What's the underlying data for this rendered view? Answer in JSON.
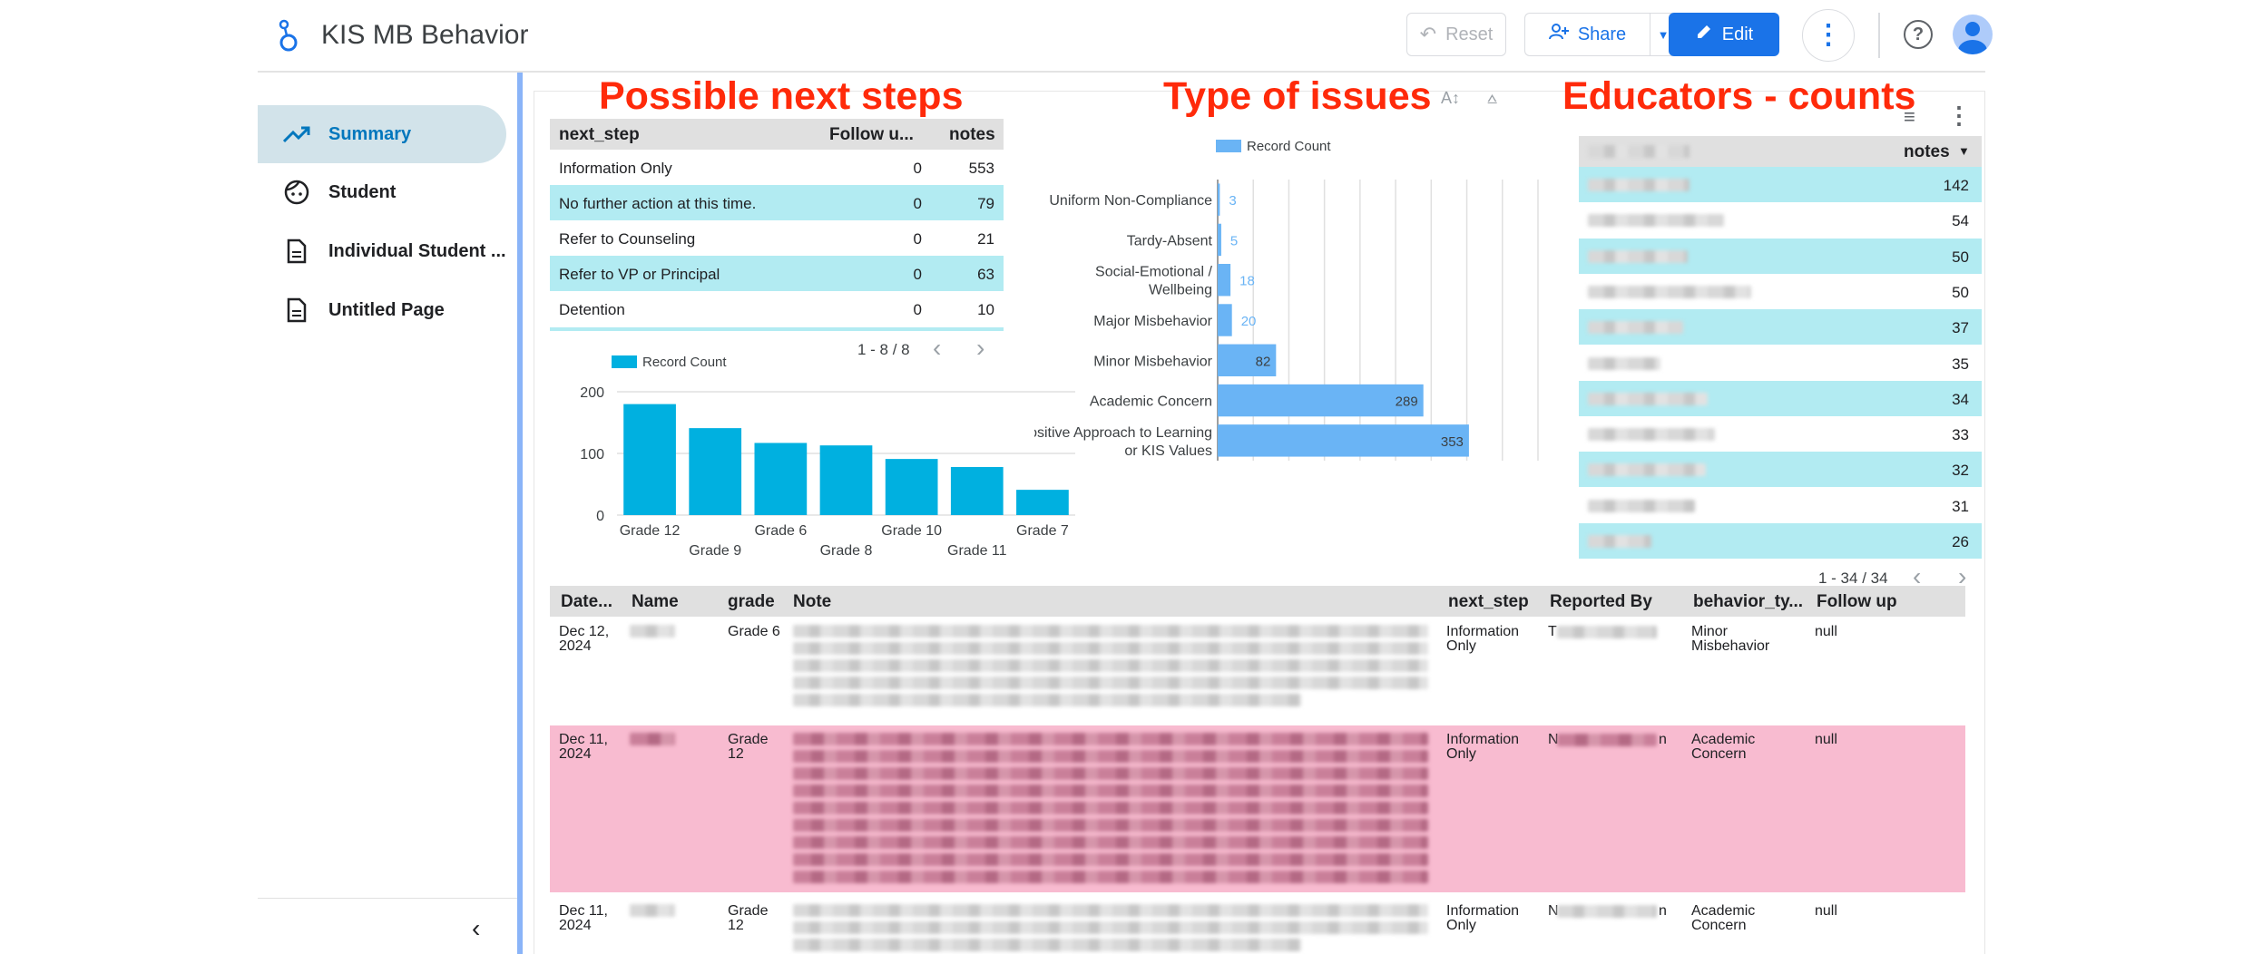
{
  "header": {
    "title": "KIS MB Behavior",
    "reset_label": "Reset",
    "share_label": "Share",
    "edit_label": "Edit"
  },
  "sidebar": {
    "items": [
      {
        "label": "Summary",
        "icon": "trending-up-icon",
        "active": true
      },
      {
        "label": "Student",
        "icon": "face-icon",
        "active": false
      },
      {
        "label": "Individual Student ...",
        "icon": "document-icon",
        "active": false
      },
      {
        "label": "Untitled Page",
        "icon": "document-icon",
        "active": false
      }
    ]
  },
  "annotations": {
    "next_steps": "Possible next steps",
    "issues": "Type of issues",
    "educators": "Educators - counts"
  },
  "next_steps_table": {
    "headers": [
      "next_step",
      "Follow u...",
      "notes"
    ],
    "rows": [
      {
        "next_step": "Information Only",
        "follow": "0",
        "notes": "553"
      },
      {
        "next_step": "No further action at this time.",
        "follow": "0",
        "notes": "79"
      },
      {
        "next_step": "Refer to Counseling",
        "follow": "0",
        "notes": "21"
      },
      {
        "next_step": "Refer to VP or Principal",
        "follow": "0",
        "notes": "63"
      },
      {
        "next_step": "Detention",
        "follow": "0",
        "notes": "10"
      }
    ],
    "pager": "1 - 8 / 8"
  },
  "chart_data": [
    {
      "type": "bar",
      "legend": "Record Count",
      "categories": [
        "Grade 12",
        "Grade 9",
        "Grade 6",
        "Grade 8",
        "Grade 10",
        "Grade 11",
        "Grade 7"
      ],
      "values": [
        180,
        141,
        117,
        113,
        91,
        78,
        41
      ],
      "ylim": [
        0,
        200
      ],
      "yticks": [
        "0",
        "100",
        "200"
      ],
      "grid": true,
      "colors": {
        "bar": "#00b0e0"
      }
    },
    {
      "type": "bar",
      "orientation": "horizontal",
      "legend": "Record Count",
      "categories": [
        "Uniform Non-Compliance",
        "Tardy-Absent",
        "Social-Emotional / Wellbeing",
        "Major Misbehavior",
        "Minor Misbehavior",
        "Academic Concern",
        "Positive Approach to Learning or KIS Values"
      ],
      "values": [
        3,
        5,
        18,
        20,
        82,
        289,
        353
      ],
      "xlim": [
        0,
        450
      ],
      "grid": true,
      "colors": {
        "bar": "#6ab4f5"
      }
    }
  ],
  "educators_table": {
    "header": "notes",
    "counts": [
      "142",
      "54",
      "50",
      "50",
      "37",
      "35",
      "34",
      "33",
      "32",
      "31",
      "26"
    ],
    "pager": "1 - 34 / 34"
  },
  "records_table": {
    "headers": [
      "Date...",
      "Name",
      "grade",
      "Note",
      "next_step",
      "Reported By",
      "behavior_ty...",
      "Follow up"
    ],
    "rows": [
      {
        "date": "Dec 12, 2024",
        "grade": "Grade 6",
        "next_step": "Information Only",
        "reported_prefix": "T",
        "behavior": "Minor Misbehavior",
        "follow": "null"
      },
      {
        "date": "Dec 11, 2024",
        "grade": "Grade 12",
        "next_step": "Information Only",
        "reported_prefix": "N",
        "reported_suffix": "n",
        "behavior": "Academic Concern",
        "follow": "null"
      },
      {
        "date": "Dec 11, 2024",
        "grade": "Grade 12",
        "next_step": "Information Only",
        "reported_prefix": "N",
        "reported_suffix": "n",
        "behavior": "Academic Concern",
        "follow": "null"
      }
    ]
  },
  "colors": {
    "accent": "#1a73e8",
    "active_nav": "#d2e3ea",
    "row_highlight": "#b2ebf2",
    "row_pink": "#f8bbd0",
    "annotation": "#ff2a0a"
  }
}
